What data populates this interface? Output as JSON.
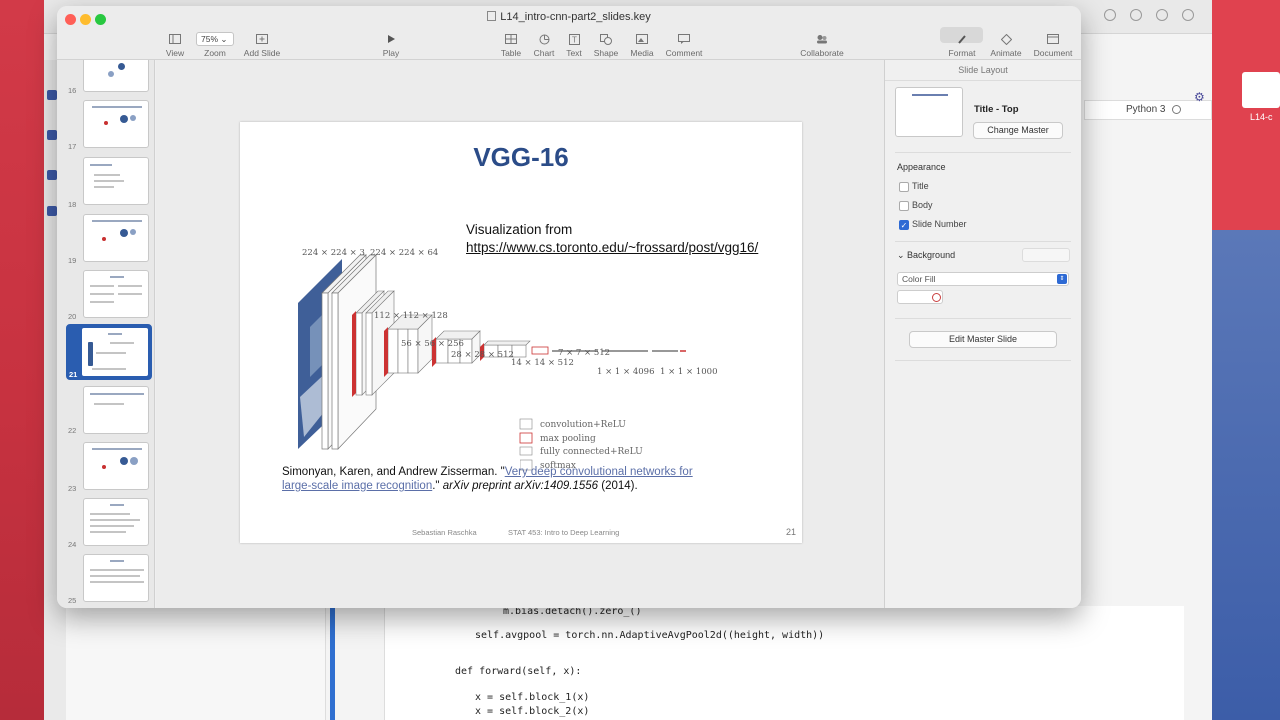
{
  "window": {
    "title": "L14_intro-cnn-part2_slides.key"
  },
  "toolbar": {
    "view": "View",
    "zoom_value": "75%",
    "zoom": "Zoom",
    "add_slide": "Add Slide",
    "play": "Play",
    "table": "Table",
    "chart": "Chart",
    "text": "Text",
    "shape": "Shape",
    "media": "Media",
    "comment": "Comment",
    "collaborate": "Collaborate",
    "format": "Format",
    "animate": "Animate",
    "document": "Document"
  },
  "navigator": {
    "slide_numbers": [
      "16",
      "17",
      "18",
      "19",
      "20",
      "21",
      "22",
      "23",
      "24",
      "25"
    ],
    "selected": "21"
  },
  "slide": {
    "title": "VGG-16",
    "viz_from": "Visualization from",
    "viz_url": "https://www.cs.toronto.edu/~frossard/post/vgg16/",
    "diagram_labels": {
      "l1": "224 × 224 × 3",
      "l2": "224 × 224 × 64",
      "l3": "112 × 112 × 128",
      "l4": "56 × 56 × 256",
      "l5": "28 × 28 × 512",
      "l6": "14 × 14 × 512",
      "l7": "7 × 7 × 512",
      "l8": "1 × 1 × 4096",
      "l9": "1 × 1 × 1000"
    },
    "legend": {
      "conv": "convolution+ReLU",
      "pool": "max pooling",
      "fc": "fully connected+ReLU",
      "softmax": "softmax"
    },
    "citation": {
      "authors": "Simonyan, Karen, and Andrew Zisserman. \"",
      "link": "Very deep convolutional networks for large-scale image recognition",
      "mid": ".\" ",
      "journal": "arXiv preprint arXiv:1409.1556",
      "year": " (2014)."
    },
    "footer_author": "Sebastian Raschka",
    "footer_course": "STAT 453: Intro to Deep Learning",
    "number": "21"
  },
  "inspector": {
    "header": "Slide Layout",
    "layout_name": "Title - Top",
    "change_master": "Change Master",
    "appearance": "Appearance",
    "title_label": "Title",
    "body_label": "Body",
    "slide_number_label": "Slide Number",
    "background": "Background",
    "fill_type": "Color Fill",
    "edit_master": "Edit Master Slide"
  },
  "background_app": {
    "kernel": "Python 3",
    "desktop_file": "L14-c",
    "code": [
      "m.bias.detach().zero_()",
      "self.avgpool = torch.nn.AdaptiveAvgPool2d((height, width))",
      "def forward(self, x):",
      "x = self.block_1(x)",
      "x = self.block_2(x)"
    ]
  },
  "colors": {
    "title_blue": "#2b4c88",
    "selection_blue": "#2a5db0",
    "desktop_red": "#d23a48"
  }
}
